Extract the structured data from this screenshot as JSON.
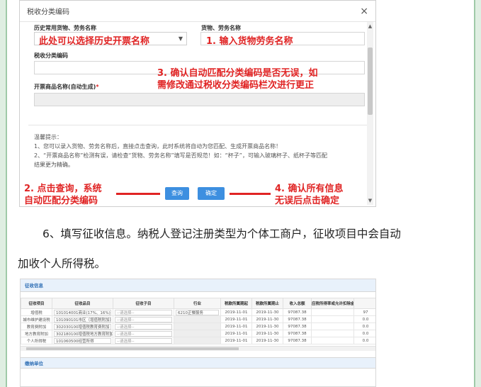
{
  "dialog": {
    "title": "税收分类编码",
    "close_glyph": "×",
    "label_history": "历史常用货物、劳务名称",
    "label_goods": "货物、劳务名称",
    "label_tax_code": "税收分类编码",
    "label_invoice_name": "开票商品名称(自动生成)",
    "required_mark": "*",
    "annotations": {
      "history_select": "此处可以选择历史开票名称",
      "goods_input": "1. 输入货物劳务名称",
      "confirm_code_line1": "3. 确认自动匹配分类编码是否无误，如",
      "confirm_code_line2": "需修改通过税收分类编码栏次进行更正",
      "click_query_line1": "2. 点击查询，系统",
      "click_query_line2": "自动匹配分类编码",
      "confirm_line1": "4. 确认所有信息",
      "confirm_line2": "无误后点击确定"
    },
    "tips": {
      "title": "温馨提示：",
      "line1": "1、您可以录入货物、劳务名称后，直接点击查询，此时系统将自动为您匹配、生成开票商品名称！",
      "line2": "2、“开票商品名称”检测有误，请检查“货物、劳务名称”填写是否规范！如：“杯子”，可输入玻璃杯子、纸杯子等匹配",
      "line3": "结果更为精确。"
    },
    "buttons": {
      "query": "查询",
      "confirm": "确定"
    }
  },
  "paragraph": {
    "line1": "6、填写征收信息。纳税人登记注册类型为个体工商户，征收项目中会自动",
    "line2": "加收个人所得税。"
  },
  "table": {
    "section_title": "征收信息",
    "section2_title": "缴纳单位",
    "columns": [
      "征收项目",
      "征收品目",
      "征收子目",
      "行业",
      "税款所属期起",
      "税款所属期止",
      "收入总额",
      "应税所得率或允许扣除金额",
      ""
    ],
    "rows": [
      [
        "增值税",
        "101014001商业(17%、16%)",
        "--请选择--",
        "6210正餐服务",
        "2019-11-01",
        "2019-11-30",
        "97087.38",
        "",
        "97"
      ],
      [
        "城市维护建设税",
        "101090101市区（增值税附加）",
        "--请选择--",
        "",
        "2019-11-01",
        "2019-11-30",
        "97087.38",
        "",
        "0.0"
      ],
      [
        "教育费附加",
        "302030100增值税教育费附加",
        "--请选择--",
        "",
        "2019-11-01",
        "2019-11-30",
        "97087.38",
        "",
        "0.0"
      ],
      [
        "地方教育附加",
        "302180100增值税地方教育附加",
        "--请选择--",
        "",
        "2019-11-01",
        "2019-11-30",
        "97087.38",
        "",
        "0.0"
      ],
      [
        "个人所得税",
        "101060500经营所得",
        "--请选择--",
        "",
        "2019-11-01",
        "2019-11-30",
        "97087.38",
        "",
        "0.0"
      ]
    ]
  },
  "colors": {
    "annotation_red": "#e02424",
    "button_blue": "#3d8fe0",
    "frame_green": "#dfeee2"
  }
}
